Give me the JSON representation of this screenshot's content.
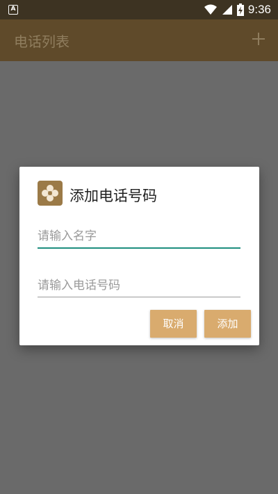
{
  "status_bar": {
    "time": "9:36"
  },
  "app_bar": {
    "title": "电话列表"
  },
  "dialog": {
    "title": "添加电话号码",
    "name_placeholder": "请输入名字",
    "phone_placeholder": "请输入电话号码",
    "cancel_label": "取消",
    "add_label": "添加"
  },
  "colors": {
    "app_bar": "#5f4a2a",
    "status_bar": "#3d3322",
    "accent_underline": "#1e8e7e",
    "button": "#d9ab6e"
  }
}
